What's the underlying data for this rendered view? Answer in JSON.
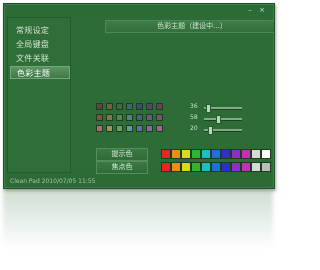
{
  "window": {
    "minimize_glyph": "–",
    "close_glyph": "×"
  },
  "sidebar": {
    "items": [
      {
        "label": "常规设定"
      },
      {
        "label": "全局键盘"
      },
      {
        "label": "文件关联"
      },
      {
        "label": "色彩主题"
      }
    ],
    "active_index": 3
  },
  "content": {
    "section_title": "色彩主题（建设中...）",
    "palette_colors": [
      [
        "#6b3f3f",
        "#6f6139",
        "#42663f",
        "#3e6768",
        "#3e4a74",
        "#5d3f72",
        "#6d3f5c"
      ],
      [
        "#8b4b4b",
        "#8a7544",
        "#4f8a4c",
        "#4b8486",
        "#4a5c8e",
        "#74508e",
        "#8a4c74"
      ],
      [
        "#b16b6b",
        "#a58e5b",
        "#64a35e",
        "#5c9ea0",
        "#5c71a8",
        "#8d67a7",
        "#a86392"
      ]
    ],
    "sliders": [
      {
        "label": "36",
        "value": 0.05
      },
      {
        "label": "58",
        "value": 0.33
      },
      {
        "label": "20",
        "value": 0.12
      }
    ],
    "text_color_label": "提示色",
    "highlight_color_label": "焦点色",
    "bar_colors": [
      [
        "#e62525",
        "#e98f17",
        "#dada1b",
        "#2fb52f",
        "#1abfbf",
        "#1d72d8",
        "#2f2fc9",
        "#8a2fc9",
        "#c92fb4",
        "#d8d8d8",
        "#ffffff"
      ],
      [
        "#e62525",
        "#e98f17",
        "#dada1b",
        "#2fb52f",
        "#1abfbf",
        "#1d72d8",
        "#2f2fc9",
        "#8a2fc9",
        "#c92fb4",
        "#d8d8d8",
        "#bdbdbd"
      ]
    ]
  },
  "statusbar": {
    "text": "Clean Pad  2010/07/05 11:55"
  }
}
